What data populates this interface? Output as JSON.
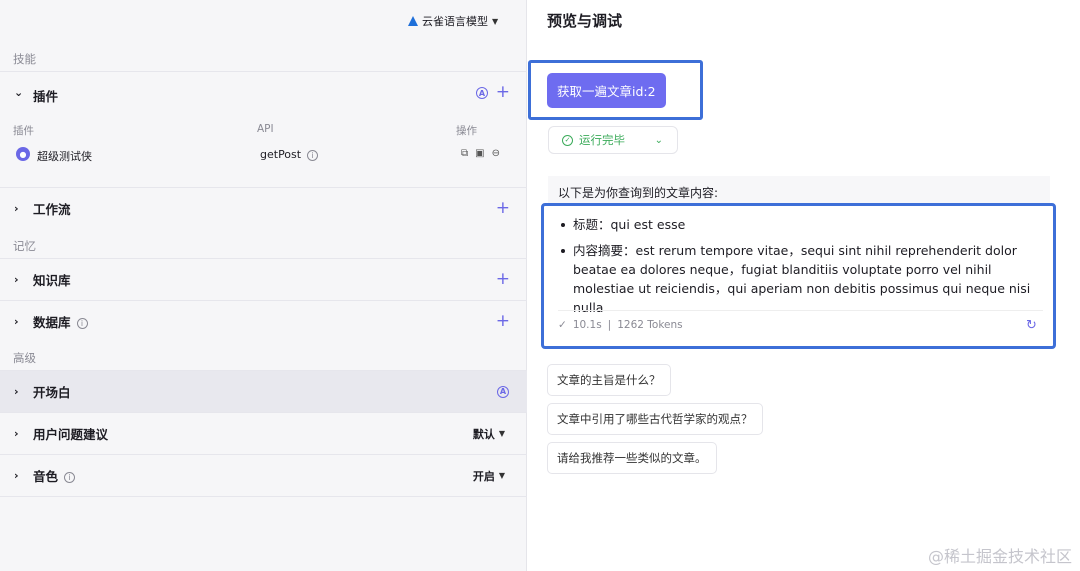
{
  "model": {
    "name": "云雀语言模型"
  },
  "sections": {
    "skills": "技能",
    "memory": "记忆",
    "advanced": "高级"
  },
  "plugins": {
    "title": "插件",
    "columns": {
      "name": "插件",
      "api": "API",
      "ops": "操作"
    },
    "items": [
      {
        "name": "超级测试侠",
        "api": "getPost"
      }
    ]
  },
  "workflow": {
    "title": "工作流"
  },
  "knowledge": {
    "title": "知识库"
  },
  "database": {
    "title": "数据库"
  },
  "opening": {
    "title": "开场白"
  },
  "suggestions_setting": {
    "title": "用户问题建议",
    "value": "默认"
  },
  "voice": {
    "title": "音色",
    "value": "开启"
  },
  "preview": {
    "title": "预览与调试",
    "user_message": "获取一遍文章id:2",
    "status": "运行完毕",
    "answer_intro": "以下是为你查询到的文章内容:",
    "answer_items": [
      "标题：qui est esse",
      "内容摘要：est rerum tempore vitae，sequi sint nihil reprehenderit dolor beatae ea dolores neque，fugiat blanditiis voluptate porro vel nihil molestiae ut reiciendis，qui aperiam non debitis possimus qui neque nisi nulla"
    ],
    "time": "10.1s",
    "tokens": "1262 Tokens",
    "suggested_questions": [
      "文章的主旨是什么？",
      "文章中引用了哪些古代哲学家的观点？",
      "请给我推荐一些类似的文章。"
    ]
  },
  "watermark": "@稀土掘金技术社区",
  "colors": {
    "accent": "#6e6cf0",
    "success": "#3bab5a",
    "highlight_border": "#3d6fd8"
  }
}
